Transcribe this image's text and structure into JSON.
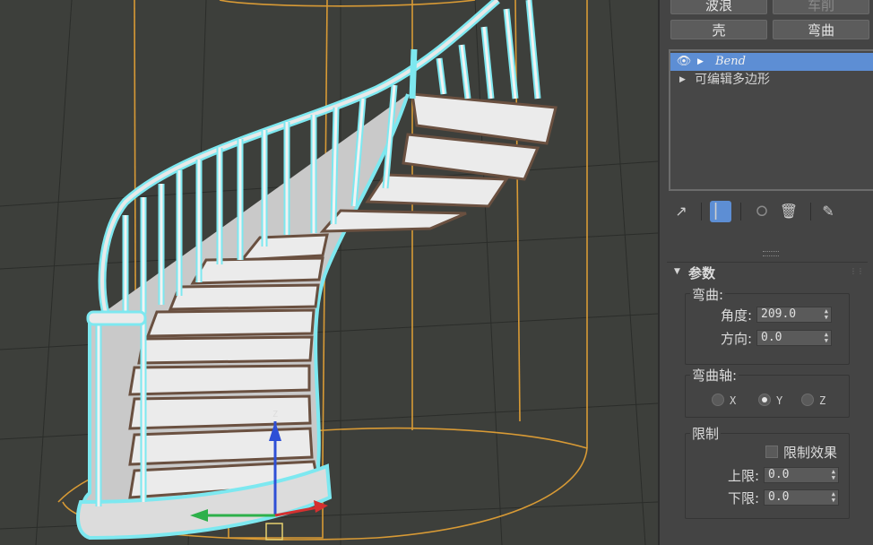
{
  "modifier_buttons": {
    "row1_left": "波浪",
    "row1_right": "车削",
    "row2_left": "壳",
    "row2_right": "弯曲"
  },
  "modifier_stack": {
    "items": [
      {
        "label": "Bend"
      },
      {
        "label": "可编辑多边形"
      }
    ]
  },
  "stack_tools": {
    "pin": "pin-icon",
    "show_end_result": "show-end-result-icon",
    "make_unique": "make-unique-icon",
    "remove": "trash-icon",
    "configure": "configure-sets-icon"
  },
  "rollout": {
    "title": "参数",
    "bend_group": {
      "label": "弯曲:",
      "angle_label": "角度:",
      "angle_value": "209.0",
      "direction_label": "方向:",
      "direction_value": "0.0"
    },
    "axis_group": {
      "label": "弯曲轴:",
      "x": "X",
      "y": "Y",
      "z": "Z",
      "selected": "Y"
    },
    "limit_group": {
      "label": "限制",
      "limit_effect_label": "限制效果",
      "upper_label": "上限:",
      "upper_value": "0.0",
      "lower_label": "下限:",
      "lower_value": "0.0"
    }
  },
  "colors": {
    "selection_cyan": "#7de8f0",
    "gizmo_orange": "#d89a35",
    "stack_highlight": "#5d8ed4"
  }
}
